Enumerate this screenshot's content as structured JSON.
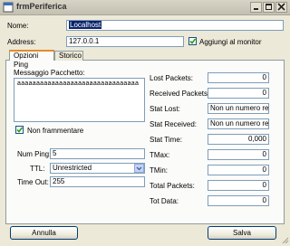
{
  "window": {
    "title": "frmPeriferica"
  },
  "form": {
    "nome_label": "Nome:",
    "nome_value": "Localhost",
    "address_label": "Address:",
    "address_value": "127.0.0.1",
    "monitor_label": "Aggiungi al monitor",
    "monitor_checked": true
  },
  "tabs": [
    {
      "label": "Opzioni Ping",
      "active": true
    },
    {
      "label": "Storico",
      "active": false
    }
  ],
  "ping": {
    "message_label": "Messaggio Pacchetto:",
    "message_value": "aaaaaaaaaaaaaaaaaaaaaaaaaaaaaaaa",
    "no_fragment_label": "Non frammentare",
    "no_fragment_checked": true,
    "num_ping_label": "Num Ping:",
    "num_ping_value": "5",
    "ttl_label": "TTL:",
    "ttl_value": "Unrestricted",
    "timeout_label": "Time Out:",
    "timeout_value": "255"
  },
  "stats": [
    {
      "label": "Lost Packets:",
      "value": "0"
    },
    {
      "label": "Received Packets:",
      "value": "0"
    },
    {
      "label": "Stat Lost:",
      "value": "Non un numero real"
    },
    {
      "label": "Stat Received:",
      "value": "Non un numero real"
    },
    {
      "label": "Stat Time:",
      "value": "0,000"
    },
    {
      "label": "TMax:",
      "value": "0"
    },
    {
      "label": "TMin:",
      "value": "0"
    },
    {
      "label": "Total Packets:",
      "value": "0"
    },
    {
      "label": "Tot Data:",
      "value": "0"
    }
  ],
  "buttons": {
    "cancel": "Annulla",
    "save": "Salva"
  },
  "colors": {
    "selection": "#0a246a",
    "tab_accent": "#e68b2c",
    "check": "#21a121"
  }
}
